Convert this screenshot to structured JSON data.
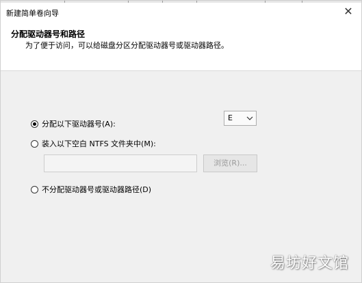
{
  "window": {
    "title": "新建简单卷向导",
    "close_glyph": "✕"
  },
  "header": {
    "title": "分配驱动器号和路径",
    "description": "为了便于访问，可以给磁盘分区分配驱动器号或驱动器路径。"
  },
  "options": {
    "assign_letter": {
      "label": "分配以下驱动器号(A):",
      "selected": true
    },
    "mount_folder": {
      "label": "装入以下空白 NTFS 文件夹中(M):",
      "selected": false
    },
    "no_assign": {
      "label": "不分配驱动器号或驱动器路径(D)",
      "selected": false
    }
  },
  "drive_letter": {
    "value": "E",
    "icon": "chevron-down-icon"
  },
  "folder_path": {
    "value": "",
    "placeholder": ""
  },
  "browse_button": {
    "label": "浏览(R)...",
    "enabled": false
  },
  "watermark": {
    "text": "易坊好文馆"
  }
}
